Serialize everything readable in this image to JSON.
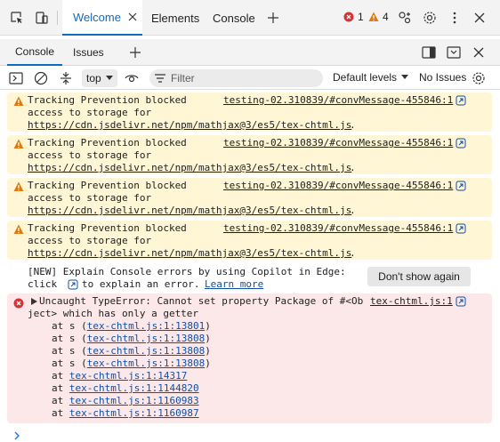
{
  "top_tabs": [
    {
      "label": "Welcome",
      "active": true,
      "closable": true
    },
    {
      "label": "Elements",
      "active": false
    },
    {
      "label": "Console",
      "active": false
    }
  ],
  "counts": {
    "errors": "1",
    "warnings": "4"
  },
  "drawer_tabs": [
    {
      "label": "Console",
      "active": true
    },
    {
      "label": "Issues",
      "active": false
    }
  ],
  "toolbar": {
    "context": "top",
    "filter_placeholder": "Filter",
    "levels": "Default levels",
    "issues": "No Issues"
  },
  "warnings": [
    {
      "line1": "Tracking Prevention blocked",
      "line2": "access to storage for",
      "url": "https://cdn.jsdelivr.net/npm/mathjax@3/es5/tex-chtml.js",
      "tail": ".",
      "source": "testing-02.310839/#convMessage-455846:1"
    },
    {
      "line1": "Tracking Prevention blocked",
      "line2": "access to storage for",
      "url": "https://cdn.jsdelivr.net/npm/mathjax@3/es5/tex-chtml.js",
      "tail": ".",
      "source": "testing-02.310839/#convMessage-455846:1"
    },
    {
      "line1": "Tracking Prevention blocked",
      "line2": "access to storage for",
      "url": "https://cdn.jsdelivr.net/npm/mathjax@3/es5/tex-chtml.js",
      "tail": ".",
      "source": "testing-02.310839/#convMessage-455846:1"
    },
    {
      "line1": "Tracking Prevention blocked",
      "line2": "access to storage for",
      "url": "https://cdn.jsdelivr.net/npm/mathjax@3/es5/tex-chtml.js",
      "tail": ".",
      "source": "testing-02.310839/#convMessage-455846:1"
    }
  ],
  "copilot": {
    "line1": "[NEW] Explain Console errors by using Copilot in Edge:",
    "pre": "click",
    "post": "to explain an error.",
    "learn_more": "Learn more",
    "dont_show": "Don't show again"
  },
  "error": {
    "line1": "Uncaught TypeError: Cannot set property Package of #<Ob",
    "line2": "ject> which has only a getter",
    "source": "tex-chtml.js:1",
    "stack": [
      {
        "pre": "at s (",
        "loc": "tex-chtml.js:1:13801",
        "post": ")"
      },
      {
        "pre": "at s (",
        "loc": "tex-chtml.js:1:13808",
        "post": ")"
      },
      {
        "pre": "at s (",
        "loc": "tex-chtml.js:1:13808",
        "post": ")"
      },
      {
        "pre": "at s (",
        "loc": "tex-chtml.js:1:13808",
        "post": ")"
      },
      {
        "pre": "at ",
        "loc": "tex-chtml.js:1:14317",
        "post": ""
      },
      {
        "pre": "at ",
        "loc": "tex-chtml.js:1:1144820",
        "post": ""
      },
      {
        "pre": "at ",
        "loc": "tex-chtml.js:1:1160983",
        "post": ""
      },
      {
        "pre": "at ",
        "loc": "tex-chtml.js:1:1160987",
        "post": ""
      }
    ]
  },
  "colors": {
    "accent": "#0f6cbd",
    "warn_bg": "#fef6d5",
    "err_bg": "#fce8e8",
    "warn_icon": "#e07a10",
    "err_icon": "#d13438"
  }
}
